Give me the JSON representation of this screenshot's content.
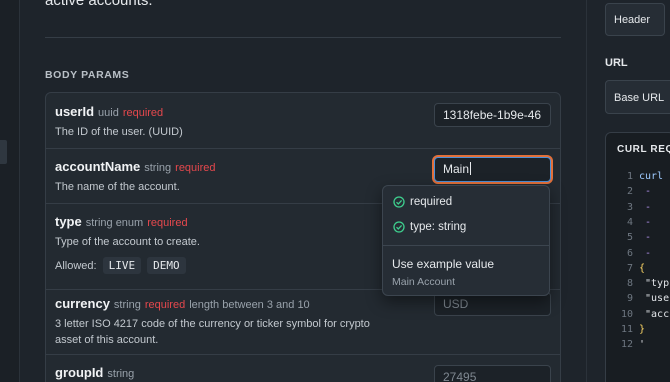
{
  "intro_text": "active accounts.",
  "section_title": "BODY PARAMS",
  "params": [
    {
      "name": "userId",
      "type": "uuid",
      "required": "required",
      "extra": "",
      "description": "The ID of the user. (UUID)",
      "value": "1318febe-1b9e-46",
      "placeholder": ""
    },
    {
      "name": "accountName",
      "type": "string",
      "required": "required",
      "extra": "",
      "description": "The name of the account.",
      "value": "Main",
      "placeholder": ""
    },
    {
      "name": "type",
      "type": "string enum",
      "required": "required",
      "extra": "",
      "description": "Type of the account to create.",
      "allowed_label": "Allowed:",
      "allowed": [
        "LIVE",
        "DEMO"
      ]
    },
    {
      "name": "currency",
      "type": "string",
      "required": "required",
      "extra": "length between 3 and 10",
      "description_line1": "3 letter ISO 4217 code of the currency or ticker symbol for crypto",
      "description_line2": "asset of this account.",
      "value": "",
      "placeholder": "USD"
    },
    {
      "name": "groupId",
      "type": "string",
      "required": "",
      "extra": "",
      "value": "",
      "placeholder": "27495"
    }
  ],
  "popup": {
    "checks": [
      "required",
      "type: string"
    ],
    "example_label": "Use example value",
    "example_value": "Main Account"
  },
  "right_panel": {
    "tab": "Header",
    "url_label": "URL",
    "base_url": "Base URL",
    "curl_title": "CURL REQUEST",
    "code_lines": [
      {
        "n": "1",
        "text": "curl -"
      },
      {
        "n": "2",
        "text": "     -"
      },
      {
        "n": "3",
        "text": "     -"
      },
      {
        "n": "4",
        "text": "     -"
      },
      {
        "n": "5",
        "text": "     -"
      },
      {
        "n": "6",
        "text": "     -"
      },
      {
        "n": "7",
        "text": "{"
      },
      {
        "n": "8",
        "text": "  \"typ"
      },
      {
        "n": "9",
        "text": "  \"use"
      },
      {
        "n": "10",
        "text": "  \"acc"
      },
      {
        "n": "11",
        "text": "}"
      },
      {
        "n": "12",
        "text": "'"
      }
    ]
  },
  "colors": {
    "required": "#e5484d",
    "focus_ring": "#e2703a",
    "check": "#3ecf8e"
  }
}
